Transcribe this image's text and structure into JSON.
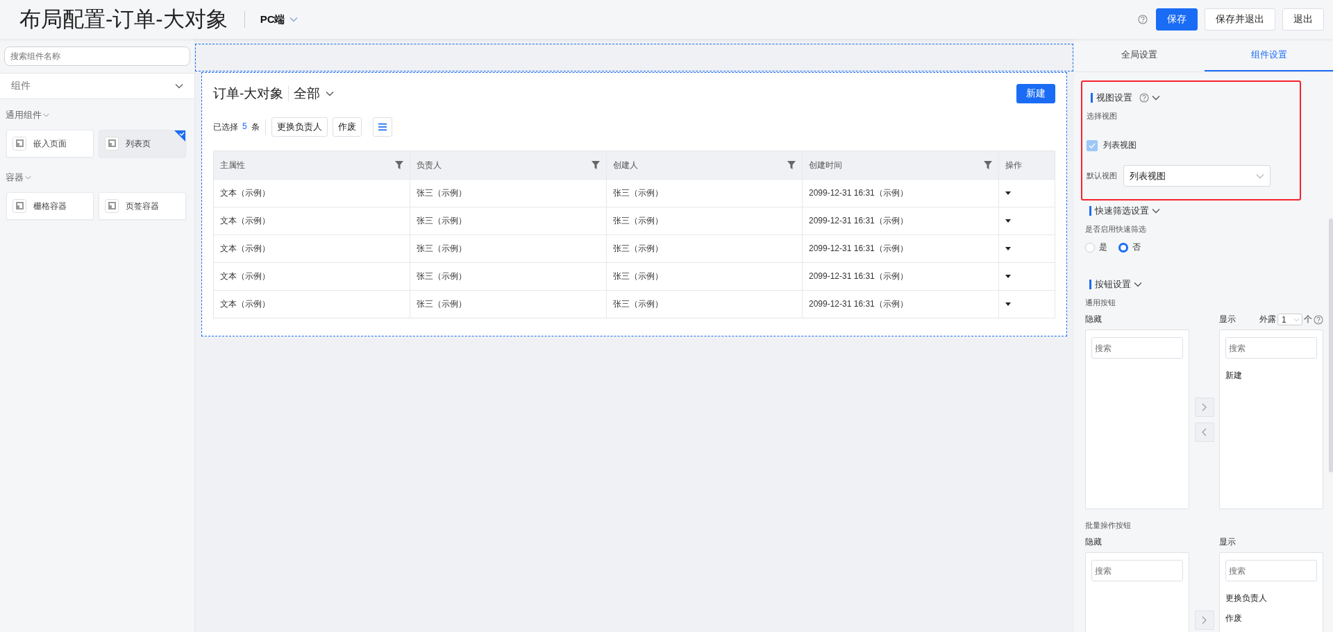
{
  "header": {
    "title": "布局配置-订单-大对象",
    "platform": "PC端",
    "buttons": [
      {
        "label": "保存",
        "kind": "primary"
      },
      {
        "label": "保存并退出",
        "kind": "default"
      },
      {
        "label": "退出",
        "kind": "default"
      }
    ]
  },
  "sidebar": {
    "search": {
      "placeholder": "搜索组件名称"
    },
    "dropdown": "组件",
    "groups": [
      {
        "title": "通用组件",
        "items": [
          {
            "label": "嵌入页面",
            "selected": false
          },
          {
            "label": "列表页",
            "selected": true
          }
        ]
      },
      {
        "title": "容器",
        "items": [
          {
            "label": "栅格容器",
            "selected": false
          },
          {
            "label": "页签容器",
            "selected": false
          }
        ]
      }
    ]
  },
  "canvas": {
    "object_title": "订单-大对象",
    "view": "全部",
    "new_button": "新建",
    "selection": {
      "prefix": "已选择",
      "count": "5",
      "suffix": "条"
    },
    "toolbar_buttons": [
      "更换负责人",
      "作废"
    ],
    "table": {
      "columns": [
        {
          "label": "主属性",
          "filter": true
        },
        {
          "label": "负责人",
          "filter": true
        },
        {
          "label": "创建人",
          "filter": true
        },
        {
          "label": "创建时间",
          "filter": true
        },
        {
          "label": "操作",
          "filter": false
        }
      ],
      "rows": [
        [
          "文本（示例）",
          "张三（示例）",
          "张三（示例）",
          "2099-12-31 16:31（示例）"
        ],
        [
          "文本（示例）",
          "张三（示例）",
          "张三（示例）",
          "2099-12-31 16:31（示例）"
        ],
        [
          "文本（示例）",
          "张三（示例）",
          "张三（示例）",
          "2099-12-31 16:31（示例）"
        ],
        [
          "文本（示例）",
          "张三（示例）",
          "张三（示例）",
          "2099-12-31 16:31（示例）"
        ],
        [
          "文本（示例）",
          "张三（示例）",
          "张三（示例）",
          "2099-12-31 16:31（示例）"
        ]
      ]
    }
  },
  "settings": {
    "tabs": [
      {
        "label": "全局设置",
        "selected": false
      },
      {
        "label": "组件设置",
        "selected": true
      }
    ],
    "view_section": {
      "title": "视图设置",
      "highlighted": true,
      "select_label": "选择视图",
      "views": [
        {
          "label": "列表视图",
          "checked": true,
          "disabled": true
        }
      ],
      "default_label": "默认视图",
      "default_value": "列表视图"
    },
    "quick_filter": {
      "title": "快速筛选设置",
      "question": "是否启用快速筛选",
      "options": [
        {
          "label": "是",
          "selected": false
        },
        {
          "label": "否",
          "selected": true
        }
      ]
    },
    "button_section": {
      "title": "按钮设置",
      "groups": [
        {
          "title": "通用按钮",
          "hidden_label": "隐藏",
          "shown_label": "显示",
          "expose": {
            "label": "外露",
            "value": "1",
            "unit": "个"
          },
          "hidden_placeholder": "搜索",
          "shown_placeholder": "搜索",
          "shown_items": [
            "新建"
          ],
          "move_buttons": [
            {
              "kind": "right"
            },
            {
              "kind": "left"
            }
          ]
        },
        {
          "title": "批量操作按钮",
          "hidden_label": "隐藏",
          "shown_label": "显示",
          "hidden_placeholder": "搜索",
          "shown_placeholder": "搜索",
          "shown_items": [
            "更换负责人",
            "作废"
          ],
          "move_buttons": [
            {
              "kind": "right"
            }
          ]
        }
      ]
    }
  }
}
